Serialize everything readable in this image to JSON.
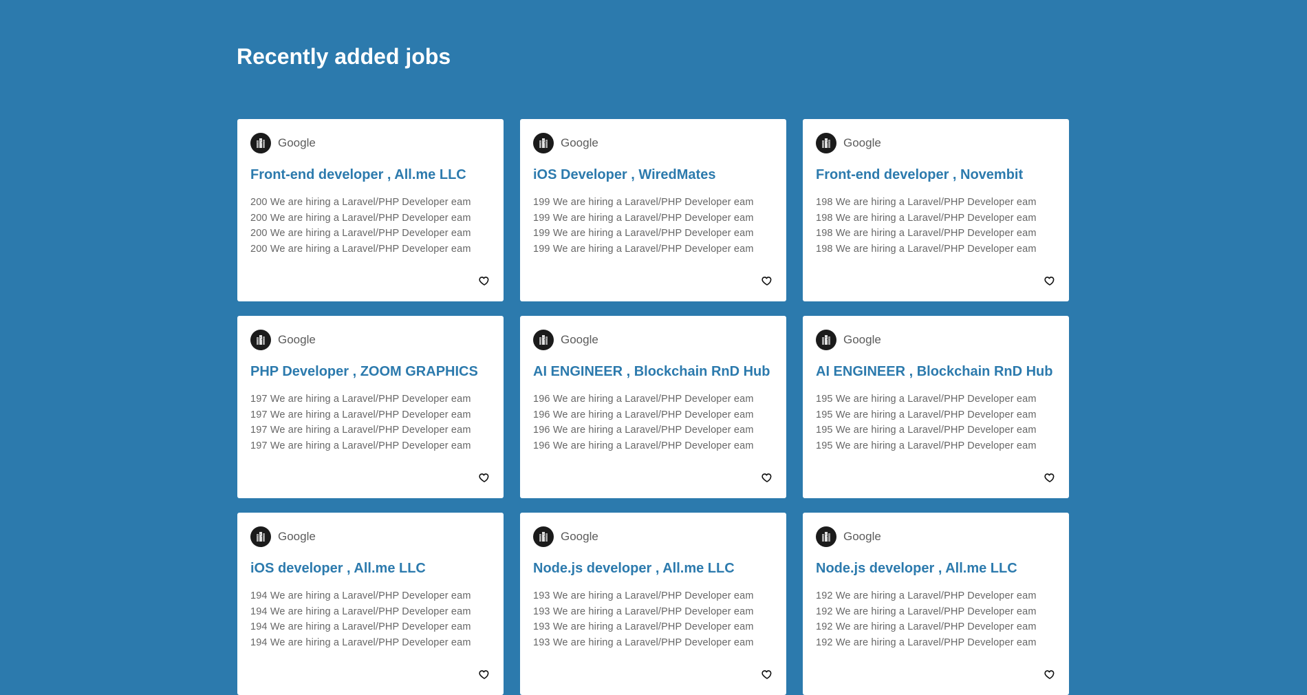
{
  "page": {
    "title": "Recently added jobs"
  },
  "jobs": [
    {
      "company": "Google",
      "title": "Front-end developer , All.me LLC",
      "description": [
        "200 We are hiring a Laravel/PHP Developer eam",
        "200 We are hiring a Laravel/PHP Developer eam",
        "200 We are hiring a Laravel/PHP Developer eam",
        "200 We are hiring a Laravel/PHP Developer eam"
      ]
    },
    {
      "company": "Google",
      "title": "iOS Developer , WiredMates",
      "description": [
        "199 We are hiring a Laravel/PHP Developer eam",
        "199 We are hiring a Laravel/PHP Developer eam",
        "199 We are hiring a Laravel/PHP Developer eam",
        "199 We are hiring a Laravel/PHP Developer eam"
      ]
    },
    {
      "company": "Google",
      "title": "Front-end developer , Novembit",
      "description": [
        "198 We are hiring a Laravel/PHP Developer eam",
        "198 We are hiring a Laravel/PHP Developer eam",
        "198 We are hiring a Laravel/PHP Developer eam",
        "198 We are hiring a Laravel/PHP Developer eam"
      ]
    },
    {
      "company": "Google",
      "title": "PHP Developer , ZOOM GRAPHICS",
      "description": [
        "197 We are hiring a Laravel/PHP Developer eam",
        "197 We are hiring a Laravel/PHP Developer eam",
        "197 We are hiring a Laravel/PHP Developer eam",
        "197 We are hiring a Laravel/PHP Developer eam"
      ]
    },
    {
      "company": "Google",
      "title": "AI ENGINEER , Blockchain RnD Hub",
      "description": [
        "196 We are hiring a Laravel/PHP Developer eam",
        "196 We are hiring a Laravel/PHP Developer eam",
        "196 We are hiring a Laravel/PHP Developer eam",
        "196 We are hiring a Laravel/PHP Developer eam"
      ]
    },
    {
      "company": "Google",
      "title": "AI ENGINEER , Blockchain RnD Hub",
      "description": [
        "195 We are hiring a Laravel/PHP Developer eam",
        "195 We are hiring a Laravel/PHP Developer eam",
        "195 We are hiring a Laravel/PHP Developer eam",
        "195 We are hiring a Laravel/PHP Developer eam"
      ]
    },
    {
      "company": "Google",
      "title": "iOS developer , All.me LLC",
      "description": [
        "194 We are hiring a Laravel/PHP Developer eam",
        "194 We are hiring a Laravel/PHP Developer eam",
        "194 We are hiring a Laravel/PHP Developer eam",
        "194 We are hiring a Laravel/PHP Developer eam"
      ]
    },
    {
      "company": "Google",
      "title": "Node.js developer , All.me LLC",
      "description": [
        "193 We are hiring a Laravel/PHP Developer eam",
        "193 We are hiring a Laravel/PHP Developer eam",
        "193 We are hiring a Laravel/PHP Developer eam",
        "193 We are hiring a Laravel/PHP Developer eam"
      ]
    },
    {
      "company": "Google",
      "title": "Node.js developer , All.me LLC",
      "description": [
        "192 We are hiring a Laravel/PHP Developer eam",
        "192 We are hiring a Laravel/PHP Developer eam",
        "192 We are hiring a Laravel/PHP Developer eam",
        "192 We are hiring a Laravel/PHP Developer eam"
      ]
    }
  ],
  "icons": {
    "company_logo": "company-logo",
    "favorite": "heart-outline-icon"
  },
  "colors": {
    "background": "#2c7aad",
    "card": "#ffffff",
    "accent": "#2c7aad",
    "company_text": "#5b5b5b",
    "description_text": "#666666"
  }
}
